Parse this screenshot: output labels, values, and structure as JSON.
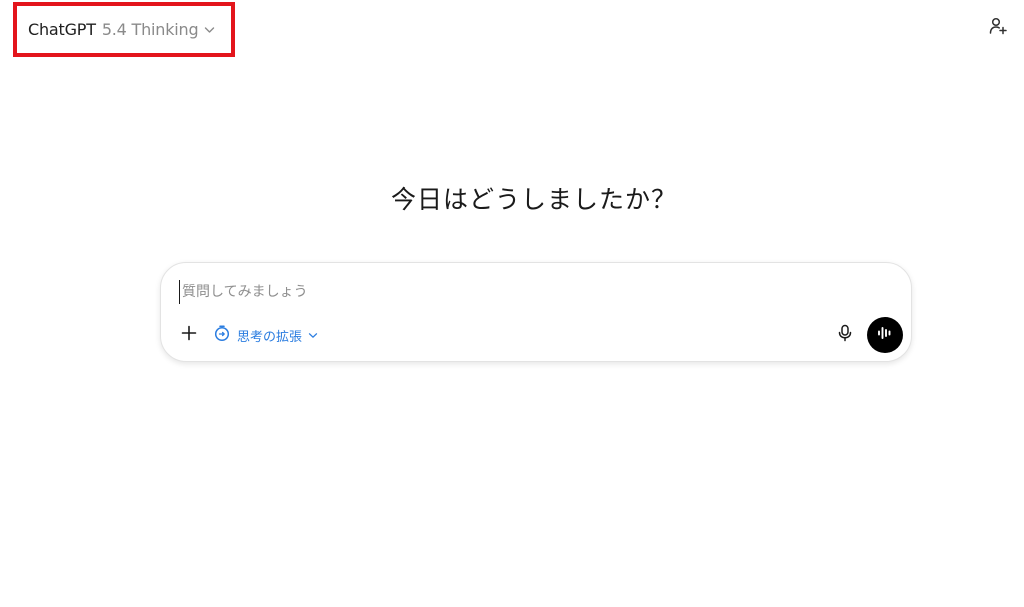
{
  "header": {
    "model_name": "ChatGPT",
    "model_version": "5.4 Thinking",
    "highlight_color": "#e3151c",
    "share_icon": "person-add-icon"
  },
  "main": {
    "greeting": "今日はどうしましたか？"
  },
  "composer": {
    "placeholder": "質問してみましょう",
    "value": "",
    "thinking_mode_label": "思考の拡張",
    "accent_color": "#2b7de0",
    "icons": {
      "add": "plus-icon",
      "thinking": "thinking-clock-icon",
      "mic": "microphone-icon",
      "voice": "voice-waveform-icon"
    }
  }
}
